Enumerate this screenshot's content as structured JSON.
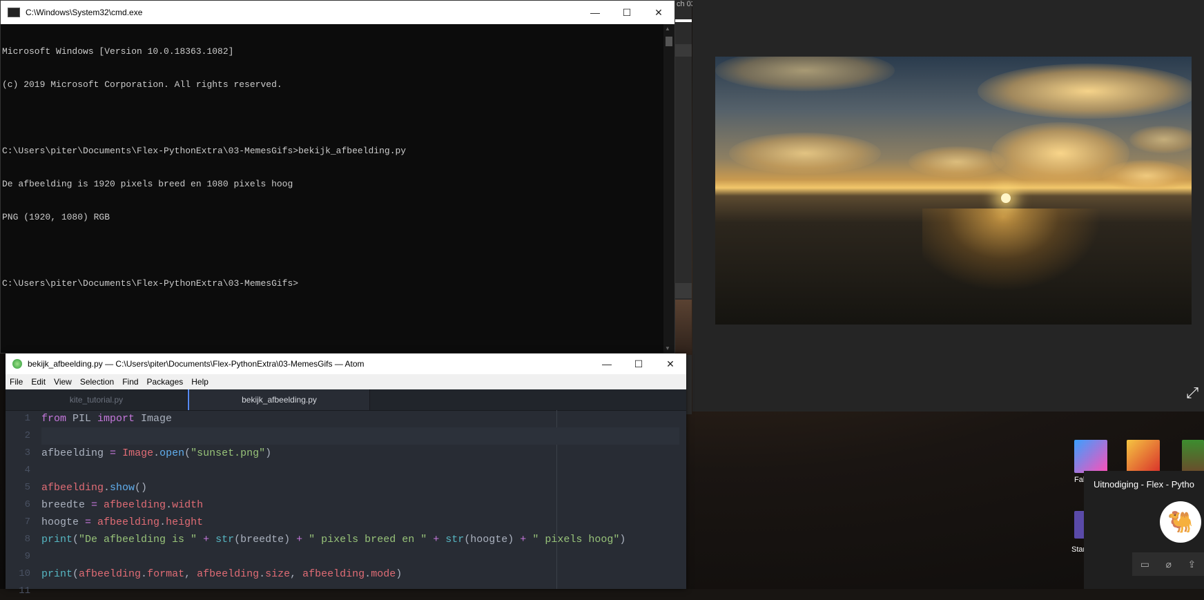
{
  "background_window": {
    "fragment_text": "ch 03"
  },
  "cmd": {
    "title": "C:\\Windows\\System32\\cmd.exe",
    "lines": [
      "Microsoft Windows [Version 10.0.18363.1082]",
      "(c) 2019 Microsoft Corporation. All rights reserved.",
      "",
      "C:\\Users\\piter\\Documents\\Flex-PythonExtra\\03-MemesGifs>bekijk_afbeelding.py",
      "De afbeelding is 1920 pixels breed en 1080 pixels hoog",
      "PNG (1920, 1080) RGB",
      "",
      "C:\\Users\\piter\\Documents\\Flex-PythonExtra\\03-MemesGifs>"
    ]
  },
  "desktop": {
    "icons": [
      {
        "label": "Fal",
        "icon": "fall-guys-icon"
      },
      {
        "label": "",
        "icon": "cuphead-icon"
      },
      {
        "label": "",
        "icon": "terraria-icon"
      },
      {
        "label": "Star",
        "icon": "shortcut-icon"
      }
    ]
  },
  "notification": {
    "title": "Uitnodiging - Flex - Pytho",
    "icons": [
      "video-icon",
      "mic-off-icon",
      "share-icon"
    ]
  },
  "atom": {
    "title": "bekijk_afbeelding.py — C:\\Users\\piter\\Documents\\Flex-PythonExtra\\03-MemesGifs — Atom",
    "menu": [
      "File",
      "Edit",
      "View",
      "Selection",
      "Find",
      "Packages",
      "Help"
    ],
    "tabs": [
      "kite_tutorial.py",
      "bekijk_afbeelding.py"
    ],
    "line_numbers": [
      "1",
      "2",
      "3",
      "4",
      "5",
      "6",
      "7",
      "8",
      "9",
      "10",
      "11"
    ]
  },
  "colors": {
    "atom_bg": "#282c34",
    "keyword": "#c678dd",
    "function": "#61afef",
    "string": "#98c379",
    "variable": "#e06c75"
  }
}
